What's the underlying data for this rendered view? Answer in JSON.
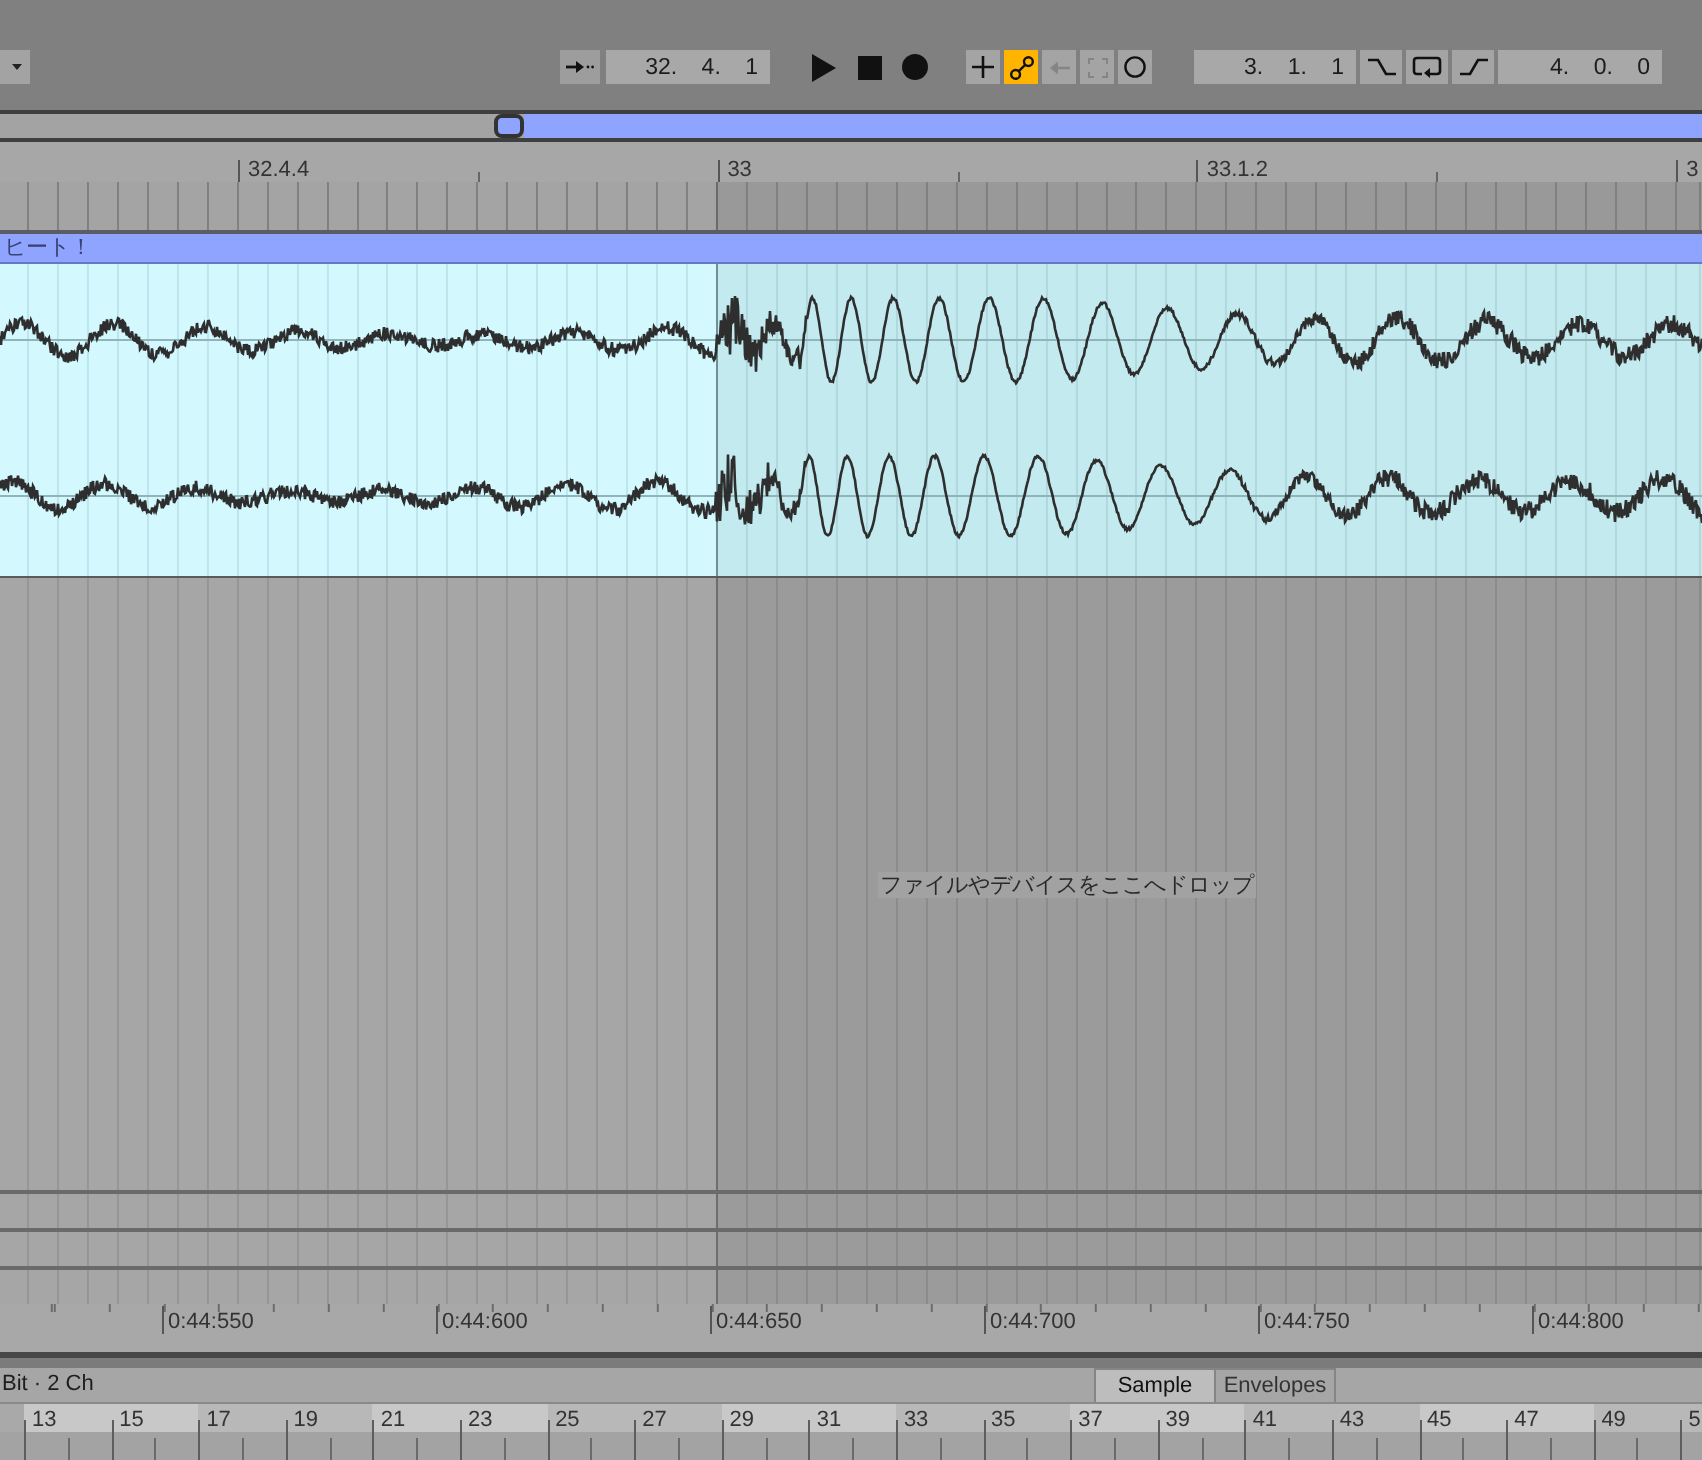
{
  "toolbar": {
    "position": "32. 4. 1",
    "edit_buttons": [
      {
        "kind": "plus",
        "on": false,
        "disabled": false
      },
      {
        "kind": "nodes",
        "on": true,
        "disabled": false
      },
      {
        "kind": "arrow",
        "on": false,
        "disabled": true
      },
      {
        "kind": "frame",
        "on": false,
        "disabled": true
      },
      {
        "kind": "circle",
        "on": false,
        "disabled": false
      }
    ],
    "loop_start": "3. 1. 1",
    "loop_buttons": [
      {
        "kind": "punch_in",
        "on": false
      },
      {
        "kind": "loop",
        "on": false
      },
      {
        "kind": "punch_out",
        "on": false
      }
    ],
    "loop_length": "4. 0. 0"
  },
  "beat_ruler": {
    "labels": [
      "32.4.4",
      "33",
      "33.1.2",
      "3"
    ]
  },
  "clip": {
    "name": "ヒート！"
  },
  "drop_area": {
    "hint": "ファイルやデバイスをここへドロップ"
  },
  "time_ruler": {
    "labels": [
      "0:44:550",
      "0:44:600",
      "0:44:650",
      "0:44:700",
      "0:44:750",
      "0:44:800"
    ]
  },
  "detail": {
    "info": "Bit · 2 Ch",
    "tabs": [
      {
        "label": "Sample",
        "selected": true
      },
      {
        "label": "Envelopes",
        "selected": false
      }
    ]
  },
  "bar_ruler": {
    "labels": [
      "13",
      "15",
      "17",
      "19",
      "21",
      "23",
      "25",
      "27",
      "29",
      "31",
      "33",
      "35",
      "37",
      "39",
      "41",
      "43",
      "45",
      "47",
      "49",
      "5"
    ]
  }
}
